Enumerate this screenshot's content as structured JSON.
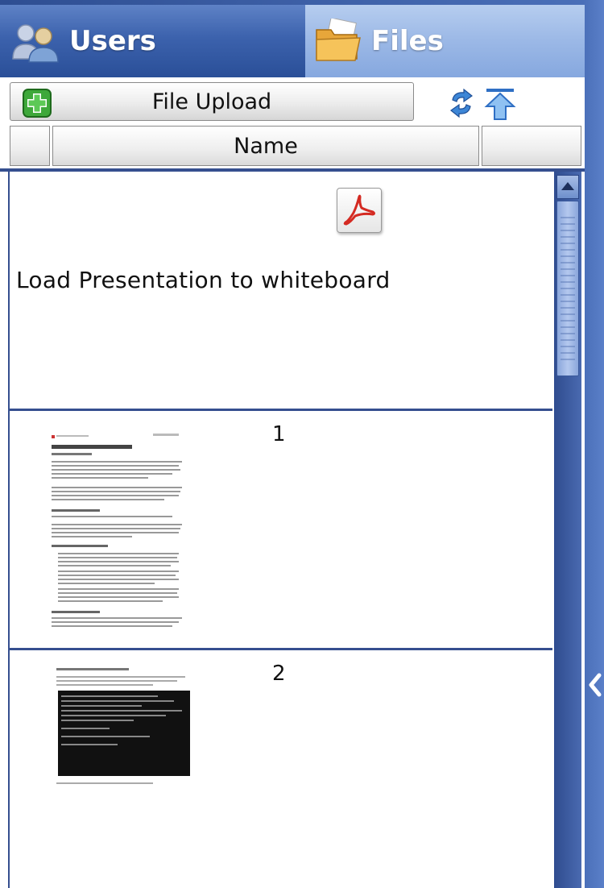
{
  "tabs": {
    "users_label": "Users",
    "files_label": "Files"
  },
  "toolbar": {
    "upload_label": "File Upload"
  },
  "table": {
    "col_checkbox": "",
    "col_name": "Name",
    "col_extra": ""
  },
  "files": [
    {
      "action_label": "Load Presentation to whiteboard",
      "icon": "pdf-icon"
    }
  ],
  "pages": [
    {
      "number": "1"
    },
    {
      "number": "2"
    }
  ],
  "colors": {
    "panel_blue": "#3a5ba0",
    "divider_blue": "#354f8f",
    "files_tab": "#9bb8e6",
    "users_tab": "#3c62ad"
  }
}
